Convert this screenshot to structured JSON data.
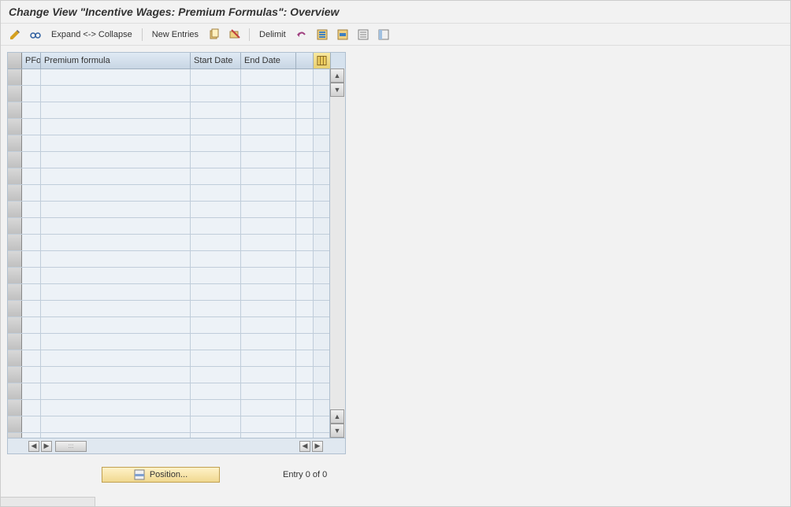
{
  "title": "Change View \"Incentive Wages: Premium Formulas\": Overview",
  "toolbar": {
    "expand_collapse": "Expand <-> Collapse",
    "new_entries": "New Entries",
    "delimit": "Delimit"
  },
  "icons": {
    "pencil": "pencil-icon",
    "glasses": "glasses-icon",
    "copy": "copy-icon",
    "delete": "delete-icon",
    "undo": "undo-icon",
    "select_all": "select-all-icon",
    "select_block": "select-block-icon",
    "deselect": "deselect-icon",
    "config": "config-icon"
  },
  "grid": {
    "columns": {
      "pfo": "PFo",
      "formula": "Premium formula",
      "start_date": "Start Date",
      "end_date": "End Date"
    },
    "row_count": 23
  },
  "footer": {
    "position_label": "Position...",
    "entry_text": "Entry 0 of 0"
  }
}
